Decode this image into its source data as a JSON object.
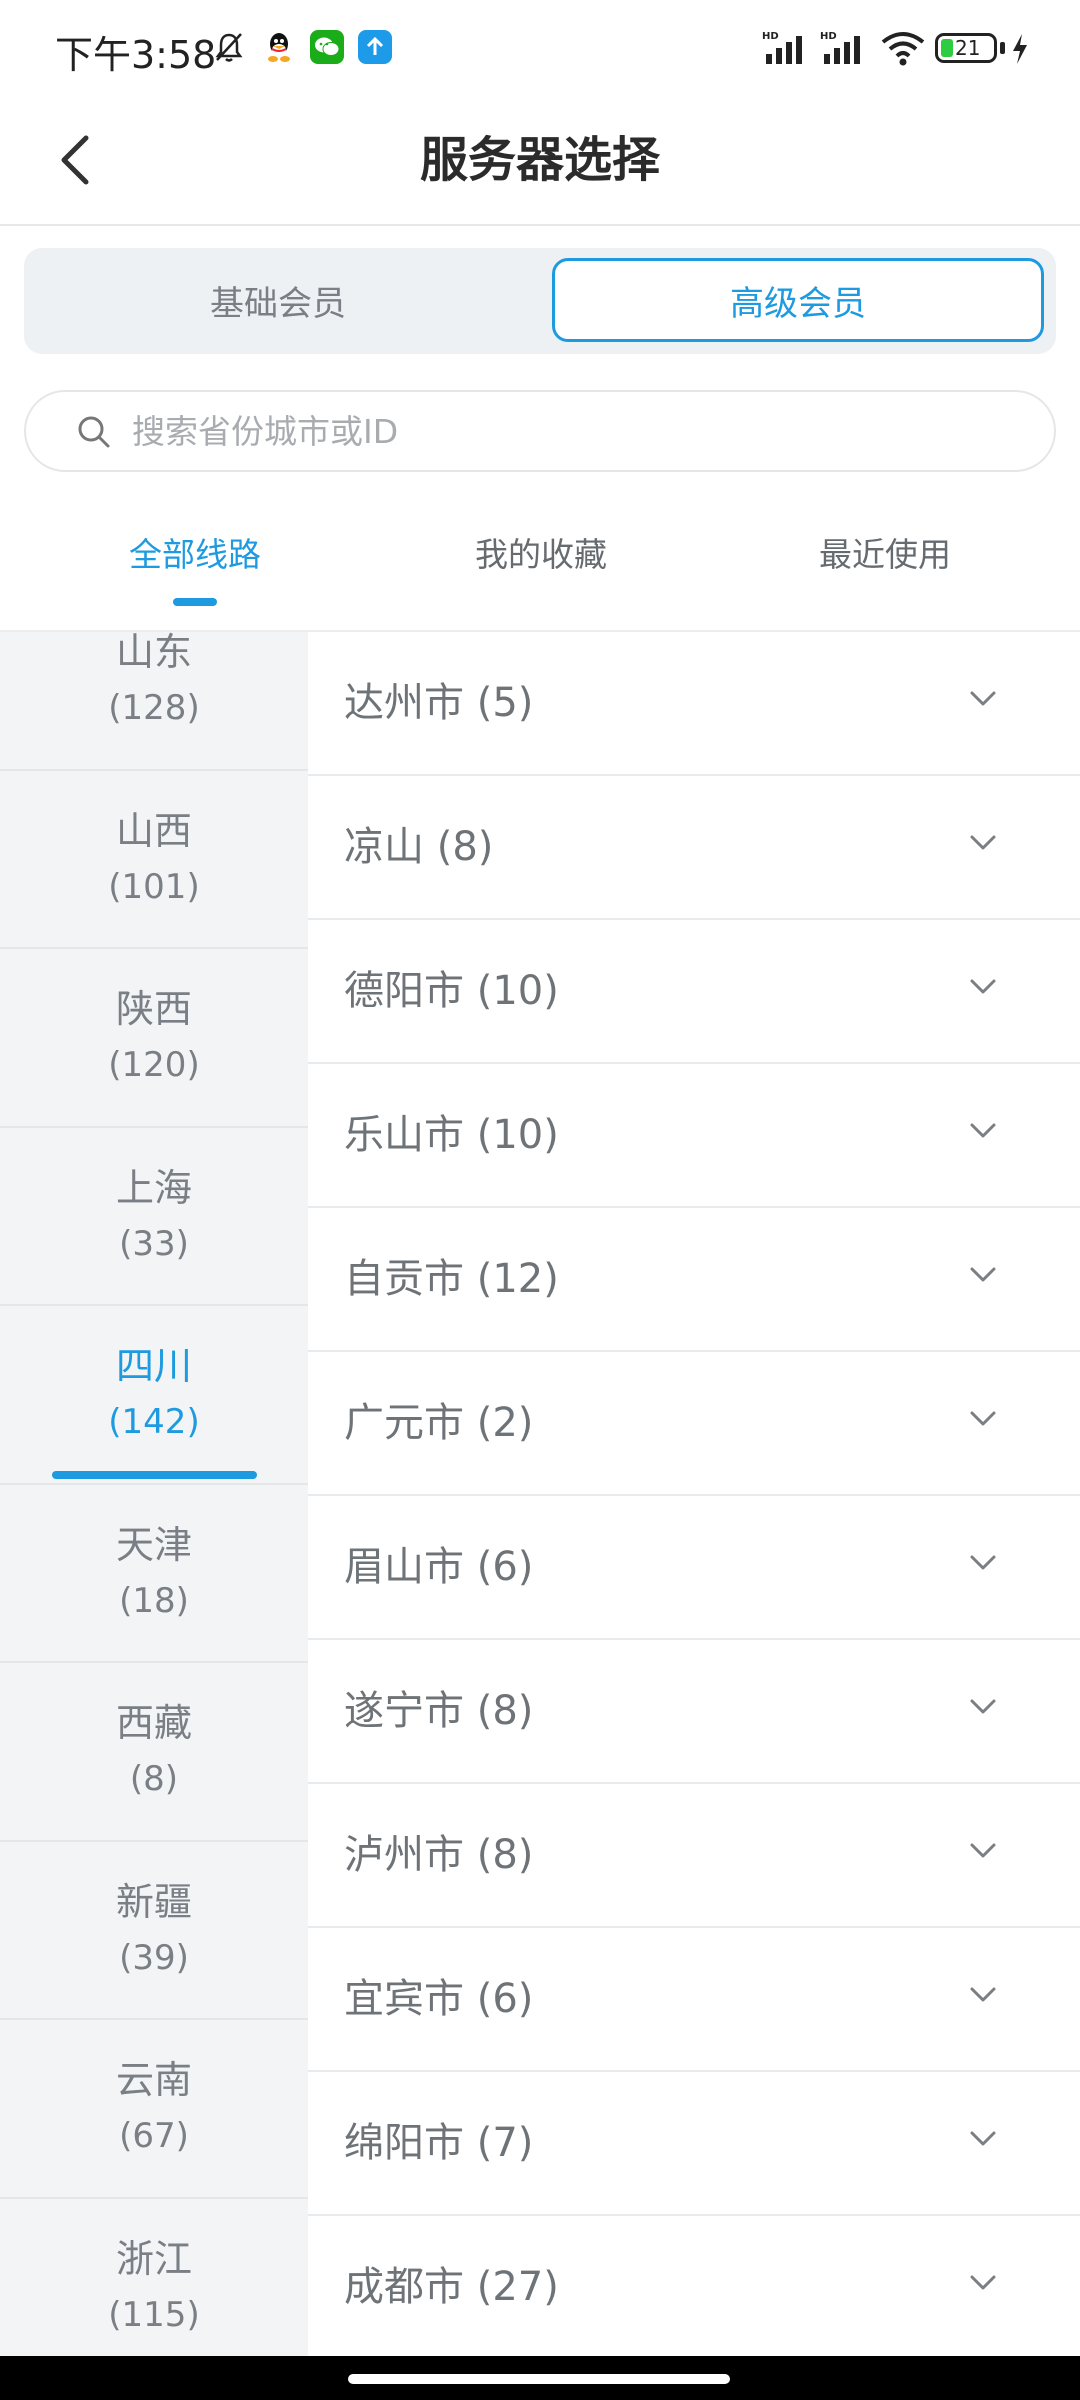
{
  "status_bar": {
    "time": "下午3:58",
    "battery_level": "21",
    "icons": [
      "mute-icon",
      "qq-icon",
      "wechat-icon",
      "upload-icon",
      "signal-icon",
      "signal-icon",
      "wifi-icon",
      "battery-icon",
      "charging-icon"
    ]
  },
  "header": {
    "title": "服务器选择",
    "back_icon": "chevron-left-icon"
  },
  "membership": {
    "basic_label": "基础会员",
    "premium_label": "高级会员",
    "selected": "premium"
  },
  "search": {
    "placeholder": "搜索省份城市或ID"
  },
  "tabs": [
    {
      "label": "全部线路",
      "active": true
    },
    {
      "label": "我的收藏",
      "active": false
    },
    {
      "label": "最近使用",
      "active": false
    }
  ],
  "provinces": [
    {
      "name": "山东",
      "count": "(128)"
    },
    {
      "name": "山西",
      "count": "(101)"
    },
    {
      "name": "陕西",
      "count": "(120)"
    },
    {
      "name": "上海",
      "count": "(33)"
    },
    {
      "name": "四川",
      "count": "(142)",
      "active": true
    },
    {
      "name": "天津",
      "count": "(18)"
    },
    {
      "name": "西藏",
      "count": "(8)"
    },
    {
      "name": "新疆",
      "count": "(39)"
    },
    {
      "name": "云南",
      "count": "(67)"
    },
    {
      "name": "浙江",
      "count": "(115)"
    }
  ],
  "cities": [
    {
      "label": "达州市 (5)"
    },
    {
      "label": "凉山 (8)"
    },
    {
      "label": "德阳市 (10)"
    },
    {
      "label": "乐山市 (10)"
    },
    {
      "label": "自贡市 (12)"
    },
    {
      "label": "广元市 (2)"
    },
    {
      "label": "眉山市 (6)"
    },
    {
      "label": "遂宁市 (8)"
    },
    {
      "label": "泸州市 (8)"
    },
    {
      "label": "宜宾市 (6)"
    },
    {
      "label": "绵阳市 (7)"
    },
    {
      "label": "成都市 (27)"
    }
  ],
  "colors": {
    "accent": "#1e9be0",
    "sidebar_bg": "#f2f4f6",
    "text_muted": "#6e7378"
  }
}
